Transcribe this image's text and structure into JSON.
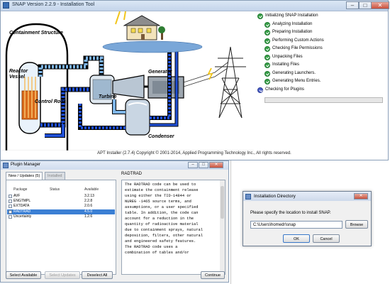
{
  "main_window": {
    "title": "SNAP Version 2.2.9 - Installation Tool",
    "footer": "APT Installer (2.7.4) Copyright © 2001-2014, Applied Programming Technology Inc., All rights reserved."
  },
  "diagram": {
    "labels": {
      "containment": "Containment Structure",
      "reactor": "Reactor\nVessel",
      "reactor_line1": "Reactor",
      "reactor_line2": "Vessel",
      "control_rods": "Control Rods",
      "turbine": "Turbine",
      "generator": "Generator",
      "condenser": "Condenser"
    }
  },
  "install_steps": {
    "items": [
      {
        "label": "Initializing SNAP Installation",
        "state": "done"
      },
      {
        "label": "Analyzing Installation",
        "state": "done"
      },
      {
        "label": "Preparing Installation",
        "state": "done"
      },
      {
        "label": "Performing Custom Actions",
        "state": "done"
      },
      {
        "label": "Checking File Permissions",
        "state": "done"
      },
      {
        "label": "Unpacking Files",
        "state": "done"
      },
      {
        "label": "Installing Files",
        "state": "done"
      },
      {
        "label": "Generating Launchers.",
        "state": "done"
      },
      {
        "label": "Generating Menu Entries.",
        "state": "done"
      },
      {
        "label": "Checking for Plugins",
        "state": "active"
      }
    ],
    "progress": 0.0
  },
  "plugin_manager": {
    "title": "Plugin Manager",
    "tabs": [
      "New / Updates (5)",
      "Installed"
    ],
    "columns": [
      "Package",
      "Status",
      "Available"
    ],
    "rows": [
      {
        "name": "AVF",
        "version": "3.2.13",
        "selected": false
      },
      {
        "name": "ENGTMPL",
        "version": "2.2.8",
        "selected": false
      },
      {
        "name": "EXTDATA",
        "version": "2.0.6",
        "selected": false
      },
      {
        "name": "RADTRAD",
        "version": "4.5.0",
        "selected": true
      },
      {
        "name": "Uncertainty",
        "version": "1.2.6",
        "selected": false
      }
    ],
    "description_title": "RADTRAD",
    "description": "The RADTRAD code can be used to\nestimate the containment release\nusing either the TID-14844 or\nNUREG -1465 source terms, and\nassumptions, or a user specified\ntable. In addition, the code can\naccount for a reduction in the\nquantity of radioactive material\ndue to containment sprays, natural\ndeposition, filters, other natural\nand engineered safety features.\nThe RADTRAD code uses a\ncombination of tables and/or",
    "buttons": {
      "select_available": "Select Available",
      "select_updates": "Select Updates",
      "deselect_all": "Deselect All",
      "continue": "Continue"
    }
  },
  "directory_dialog": {
    "title": "Installation Directory",
    "prompt": "Please specify the location to install SNAP.",
    "path": "C:\\Users\\homedr\\snap",
    "browse": "Browse",
    "ok": "OK",
    "cancel": "Cancel"
  },
  "colors": {
    "pipe_hot": "#7fb6e8",
    "pipe_cold": "#1f4fd6",
    "progress_green": "#6cc35f",
    "selection": "#3b7fd4"
  }
}
